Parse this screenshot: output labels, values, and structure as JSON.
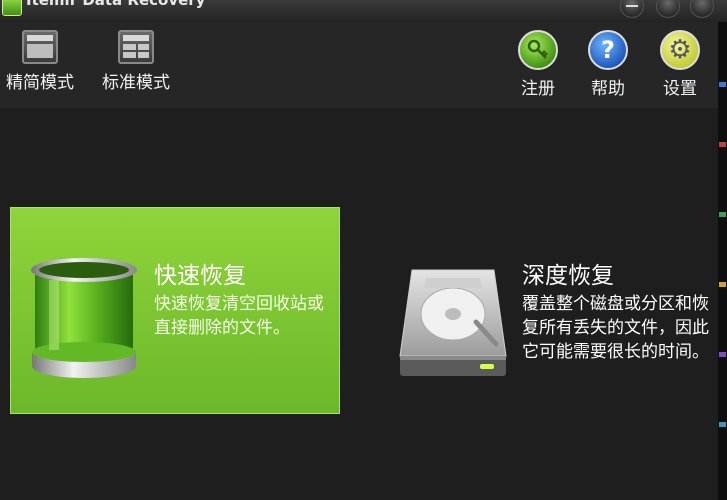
{
  "window": {
    "title": "Itemir Data Recovery"
  },
  "toolbar": {
    "left_items": [
      {
        "label": "精简模式",
        "icon": "compact-mode-icon"
      },
      {
        "label": "标准模式",
        "icon": "standard-mode-icon"
      }
    ],
    "right_items": [
      {
        "label": "注册",
        "icon": "key-icon"
      },
      {
        "label": "帮助",
        "icon": "help-icon",
        "glyph": "?"
      },
      {
        "label": "设置",
        "icon": "gear-icon",
        "glyph": "⚙"
      }
    ]
  },
  "main": {
    "quick_recovery": {
      "title": "快速恢复",
      "description": "快速恢复清空回收站或直接删除的文件。",
      "icon": "recycle-bin-icon",
      "accent": "#7cc631"
    },
    "deep_recovery": {
      "title": "深度恢复",
      "description": "覆盖整个磁盘或分区和恢复所有丢失的文件，因此它可能需要很长的时间。",
      "icon": "hard-drive-icon"
    }
  },
  "colors": {
    "background": "#1e1e1e",
    "toolbar": "#262626",
    "quick_card": "#7cc631"
  }
}
